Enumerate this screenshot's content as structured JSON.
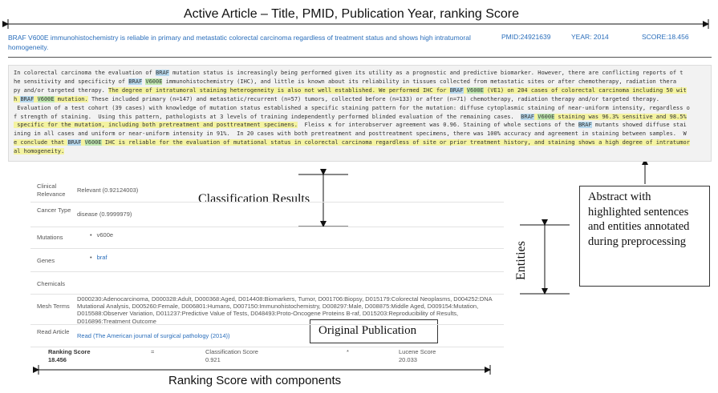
{
  "callouts": {
    "top": "Active Article – Title, PMID, Publication Year, ranking Score",
    "classification": "Classification Results",
    "entities": "Entities",
    "abstract_note": "Abstract with highlighted sentences and entities annotated during preprocessing",
    "original": "Original Publication",
    "ranking": "Ranking Score with components"
  },
  "article": {
    "title": "BRAF V600E immunohistochemistry is reliable in primary and metastatic colorectal carcinoma regardless of treatment status and shows high intratumoral homogeneity.",
    "pmid": "PMID:24921639",
    "year": "YEAR: 2014",
    "score": "SCORE:18.456"
  },
  "abstract": {
    "line1a": "In colorectal carcinoma the evaluation of ",
    "line1e": "BRAF",
    "line1b": " mutation status is increasingly being performed given its utility as a prognostic and predictive biomarker. However, there are conflicting reports of t",
    "line2a": "he sensitivity and specificity of ",
    "line2e1": "BRAF",
    "line2e2": "V600E",
    "line2b": " immunohistochemistry (IHC), and little is known about its reliability in tissues collected from metastatic sites or after chemotherapy, radiation thera",
    "line3a": "py and/or targeted therapy. ",
    "line3h": "The degree of intratumoral staining heterogeneity is also not well established. ",
    "line3h2": "We performed IHC for ",
    "line3e1": "BRAF",
    "line3e2": "V600E",
    "line3h3": " (VE1) on 204 cases of colorectal carcinoma including 50 wit",
    "line4a": "h ",
    "line4e1": "BRAF",
    "line4e2": "V600E",
    "line4b": " mutation.",
    "line4c": " These included primary (n=147) and metastatic/recurrent (n=57) tumors, collected before (n=133) or after (n=71) chemotherapy, radiation therapy and/or targeted therapy.",
    "line5": " Evaluation of a test cohort (39 cases) with knowledge of mutation status established a specific staining pattern for the mutation: diffuse cytoplasmic staining of near-uniform intensity, regardless o",
    "line6a": "f strength of staining.  Using this pattern, pathologists at 3 levels of training independently performed blinded evaluation of the remaining cases.  ",
    "line6e1": "BRAF",
    "line6e2": "V600E",
    "line6b": " staining was 96.3% sensitive and 98.5%",
    "line7a": " specific for the mutation, including both pretreatment and posttreatment specimens.",
    "line7b": "  Fleiss κ for interobserver agreement was 0.96. Staining of whole sections of the ",
    "line7e": "BRAF",
    "line7c": " mutants showed diffuse stai",
    "line8": "ining in all cases and uniform or near-uniform intensity in 91%.  In 20 cases with both pretreatment and posttreatment specimens, there was 100% accuracy and agreement in staining between samples.  W",
    "line9a": "e conclude that ",
    "line9e1": "BRAF",
    "line9e2": "V600E",
    "line9b": " IHC is reliable for the evaluation of mutational status in colorectal carcinoma regardless of site or prior treatment history, and staining shows a high degree of intratumor",
    "line10": "al homogeneity."
  },
  "details": {
    "clinical_label": "Clinical Relevance",
    "clinical_value": "Relevant (0.92124003)",
    "cancer_label": "Cancer Type",
    "cancer_value": "disease (0.9999979)",
    "mutations_label": "Mutations",
    "mutations": [
      "v600e"
    ],
    "genes_label": "Genes",
    "genes": [
      "braf"
    ],
    "chemicals_label": "Chemicals",
    "mesh_label": "Mesh Terms",
    "mesh_value": "D000230:Adenocarcinoma, D000328:Adult, D000368:Aged, D014408:Biomarkers, Tumor, D001706:Biopsy, D015179:Colorectal Neoplasms, D004252:DNA Mutational Analysis, D005260:Female, D006801:Humans, D007150:Immunohistochemistry, D008297:Male, D008875:Middle Aged, D009154:Mutation, D015588:Observer Variation, D011237:Predictive Value of Tests, D048493:Proto-Oncogene Proteins B-raf, D015203:Reproducibility of Results, D016896:Treatment Outcome",
    "read_label": "Read Article",
    "read_value": "Read (The American journal of surgical pathology (2014))"
  },
  "ranking": {
    "label": "Ranking Score",
    "value": "18.456",
    "eq": "=",
    "class_label": "Classification Score",
    "class_value": "0.921",
    "times": "*",
    "lucene_label": "Lucene Score",
    "lucene_value": "20.033"
  }
}
